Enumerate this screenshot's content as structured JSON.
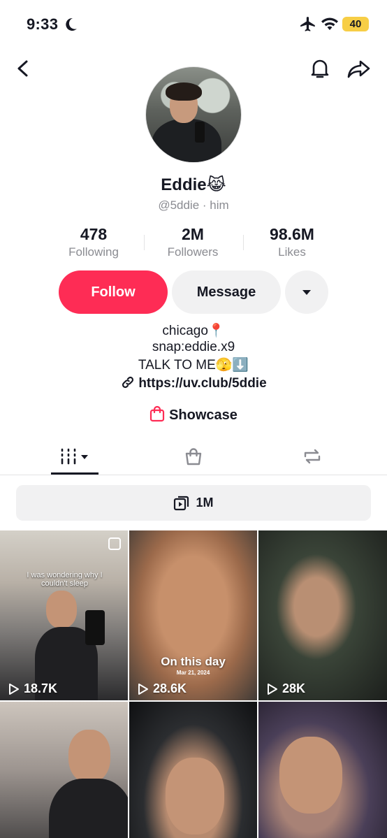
{
  "status_bar": {
    "time": "9:33",
    "battery": "40"
  },
  "profile": {
    "name": "Eddie😹",
    "handle": "@5ddie · him",
    "stats": [
      {
        "value": "478",
        "label": "Following"
      },
      {
        "value": "2M",
        "label": "Followers"
      },
      {
        "value": "98.6M",
        "label": "Likes"
      }
    ],
    "buttons": {
      "follow": "Follow",
      "message": "Message"
    },
    "bio": [
      "chicago📍",
      "snap:eddie.x9",
      "TALK TO ME🫣⬇️"
    ],
    "link": "https://uv.club/5ddie",
    "showcase": "Showcase"
  },
  "tabs": [
    "videos",
    "shop",
    "reposts"
  ],
  "playlist": {
    "label": "1M"
  },
  "videos": [
    {
      "views": "18.7K",
      "caption": "I was wondering why I couldn't sleep"
    },
    {
      "views": "28.6K",
      "title": "On this day",
      "date": "Mar 21, 2024"
    },
    {
      "views": "28K"
    },
    {
      "views": ""
    },
    {
      "views": ""
    },
    {
      "views": ""
    }
  ],
  "colors": {
    "accent": "#fe2c55",
    "text": "#161823",
    "muted": "#8a8b91",
    "surface": "#f1f1f2"
  }
}
